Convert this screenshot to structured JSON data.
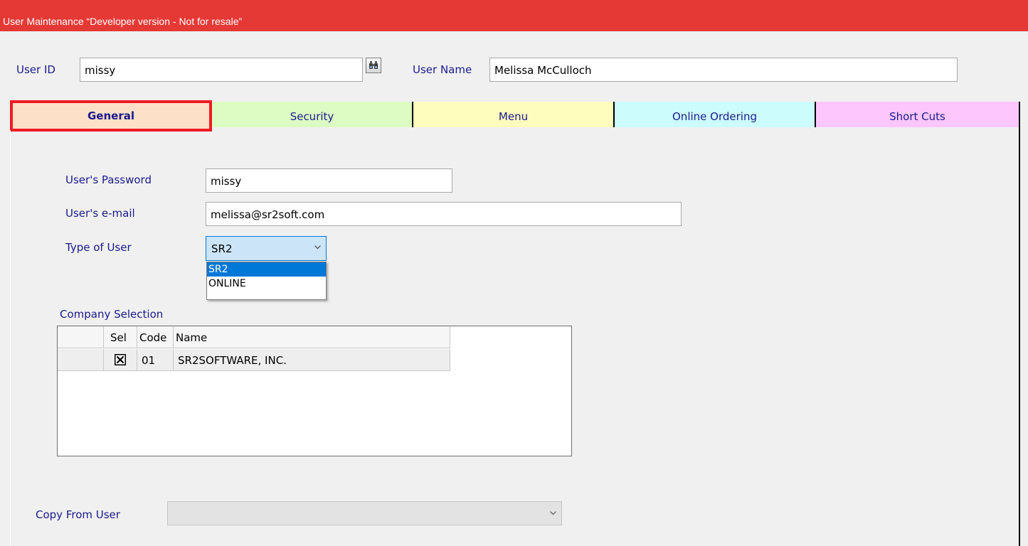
{
  "window": {
    "title": "User Maintenance “Developer version - Not for resale”"
  },
  "header": {
    "user_id_label": "User ID",
    "user_id_value": "missy",
    "lookup_icon": "binoculars-icon",
    "user_name_label": "User Name",
    "user_name_value": "Melissa McCulloch"
  },
  "tabs": [
    {
      "label": "General",
      "color": "#fde0c8",
      "active": true
    },
    {
      "label": "Security",
      "color": "#dcfcc3"
    },
    {
      "label": "Menu",
      "color": "#fefdbd"
    },
    {
      "label": "Online Ordering",
      "color": "#cdfcfd"
    },
    {
      "label": "Short Cuts",
      "color": "#fdc6fd"
    }
  ],
  "general": {
    "password_label": "User's Password",
    "password_value": "missy",
    "email_label": "User's e-mail",
    "email_value": "melissa@sr2soft.com",
    "user_type_label": "Type of User",
    "user_type_value": "SR2",
    "user_type_options": [
      "SR2",
      "ONLINE"
    ],
    "company_selection_label": "Company Selection",
    "company_grid": {
      "columns": [
        "Sel",
        "Code",
        "Name"
      ],
      "rows": [
        {
          "sel": true,
          "code": "01",
          "name": "SR2SOFTWARE, INC."
        }
      ]
    },
    "copy_from_label": "Copy From User",
    "copy_from_value": ""
  },
  "colors": {
    "titlebar": "#e53935",
    "label_text": "#1a1a8c",
    "active_tab_border": "#ee1c25",
    "selection": "#0078d7"
  }
}
